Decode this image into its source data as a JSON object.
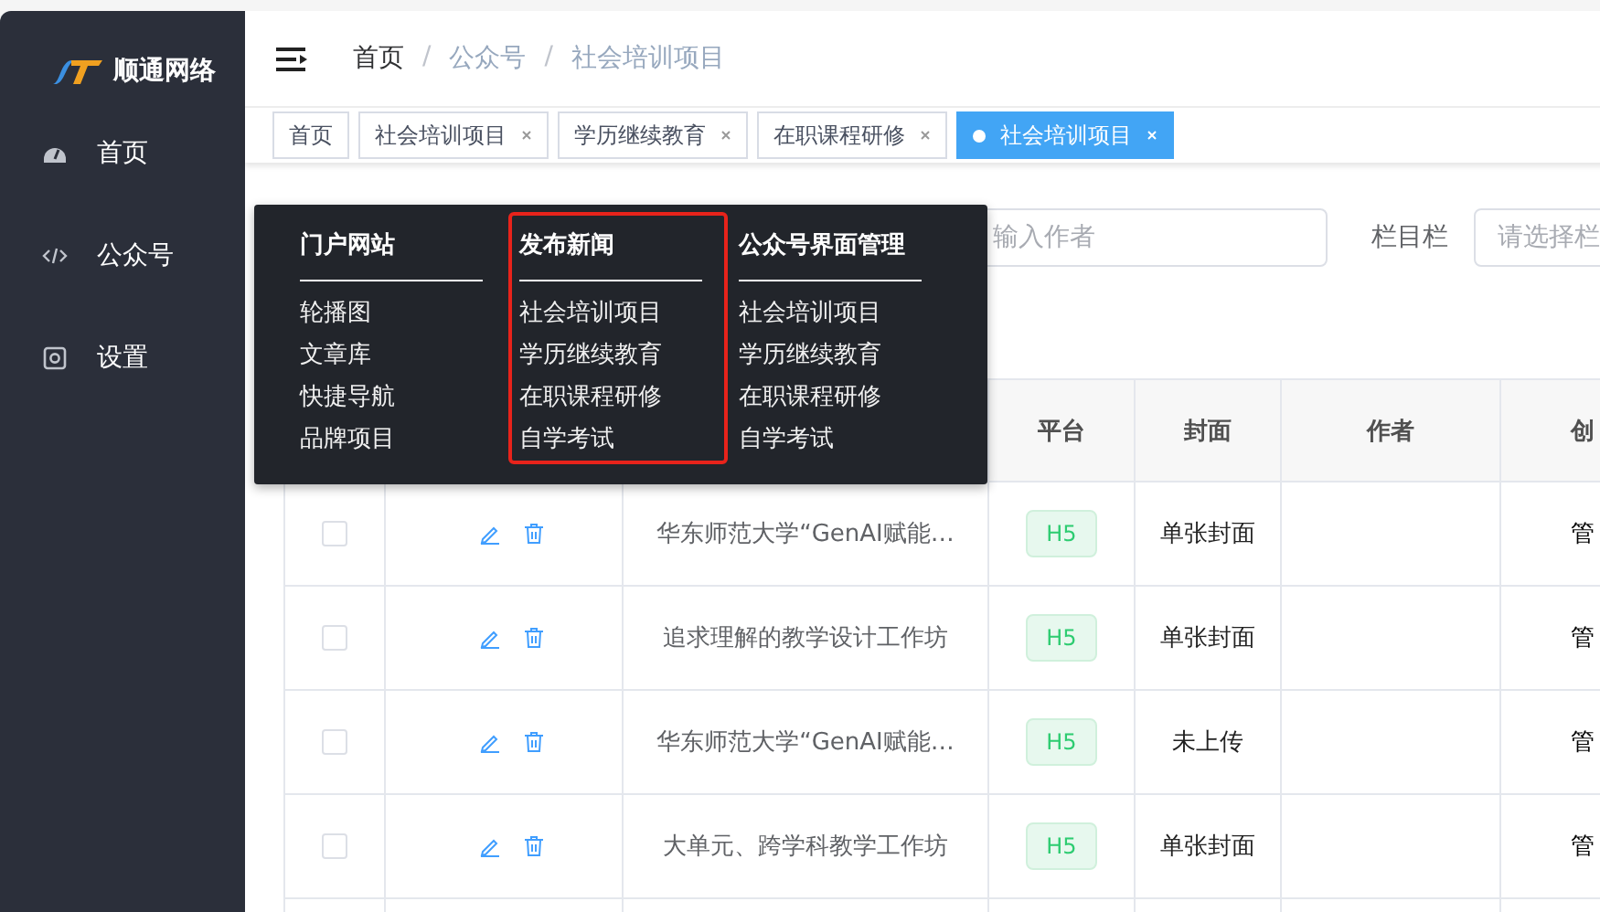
{
  "sidebar": {
    "logo_text": "顺通网络",
    "items": [
      {
        "label": "首页",
        "kind": "dashboard"
      },
      {
        "label": "公众号",
        "kind": "code"
      },
      {
        "label": "设置",
        "kind": "settings"
      }
    ]
  },
  "breadcrumb_separator": "/",
  "breadcrumb": [
    {
      "label": "首页",
      "current": false
    },
    {
      "label": "公众号",
      "current": true
    },
    {
      "label": "社会培训项目",
      "current": true
    }
  ],
  "tags": [
    {
      "label": "首页",
      "selected": false,
      "closable": false
    },
    {
      "label": "社会培训项目",
      "selected": false,
      "closable": true
    },
    {
      "label": "学历继续教育",
      "selected": false,
      "closable": true
    },
    {
      "label": "在职课程研修",
      "selected": false,
      "closable": true
    },
    {
      "label": "社会培训项目",
      "selected": true,
      "closable": true
    }
  ],
  "filters": {
    "author": {
      "placeholder": "输入作者"
    },
    "column": {
      "label": "栏目栏",
      "placeholder": "请选择栏"
    }
  },
  "mega_menu": {
    "columns": [
      {
        "heading": "门户网站",
        "highlighted": false,
        "items": [
          "轮播图",
          "文章库",
          "快捷导航",
          "品牌项目"
        ]
      },
      {
        "heading": "发布新闻",
        "highlighted": true,
        "items": [
          "社会培训项目",
          "学历继续教育",
          "在职课程研修",
          "自学考试"
        ]
      },
      {
        "heading": "公众号界面管理",
        "highlighted": false,
        "items": [
          "社会培训项目",
          "学历继续教育",
          "在职课程研修",
          "自学考试"
        ]
      }
    ]
  },
  "table": {
    "columns": [
      "平台",
      "封面",
      "作者",
      "创"
    ],
    "rows": [
      {
        "checked": false,
        "title": "华东师范大学“GenAI赋能…",
        "platform": "H5",
        "cover": "单张封面",
        "creator": "管"
      },
      {
        "checked": false,
        "title": "追求理解的教学设计工作坊",
        "platform": "H5",
        "cover": "单张封面",
        "creator": "管"
      },
      {
        "checked": false,
        "title": "华东师范大学“GenAI赋能…",
        "platform": "H5",
        "cover": "未上传",
        "creator": "管"
      },
      {
        "checked": false,
        "title": "大单元、跨学科教学工作坊",
        "platform": "H5",
        "cover": "单张封面",
        "creator": "管"
      }
    ]
  }
}
